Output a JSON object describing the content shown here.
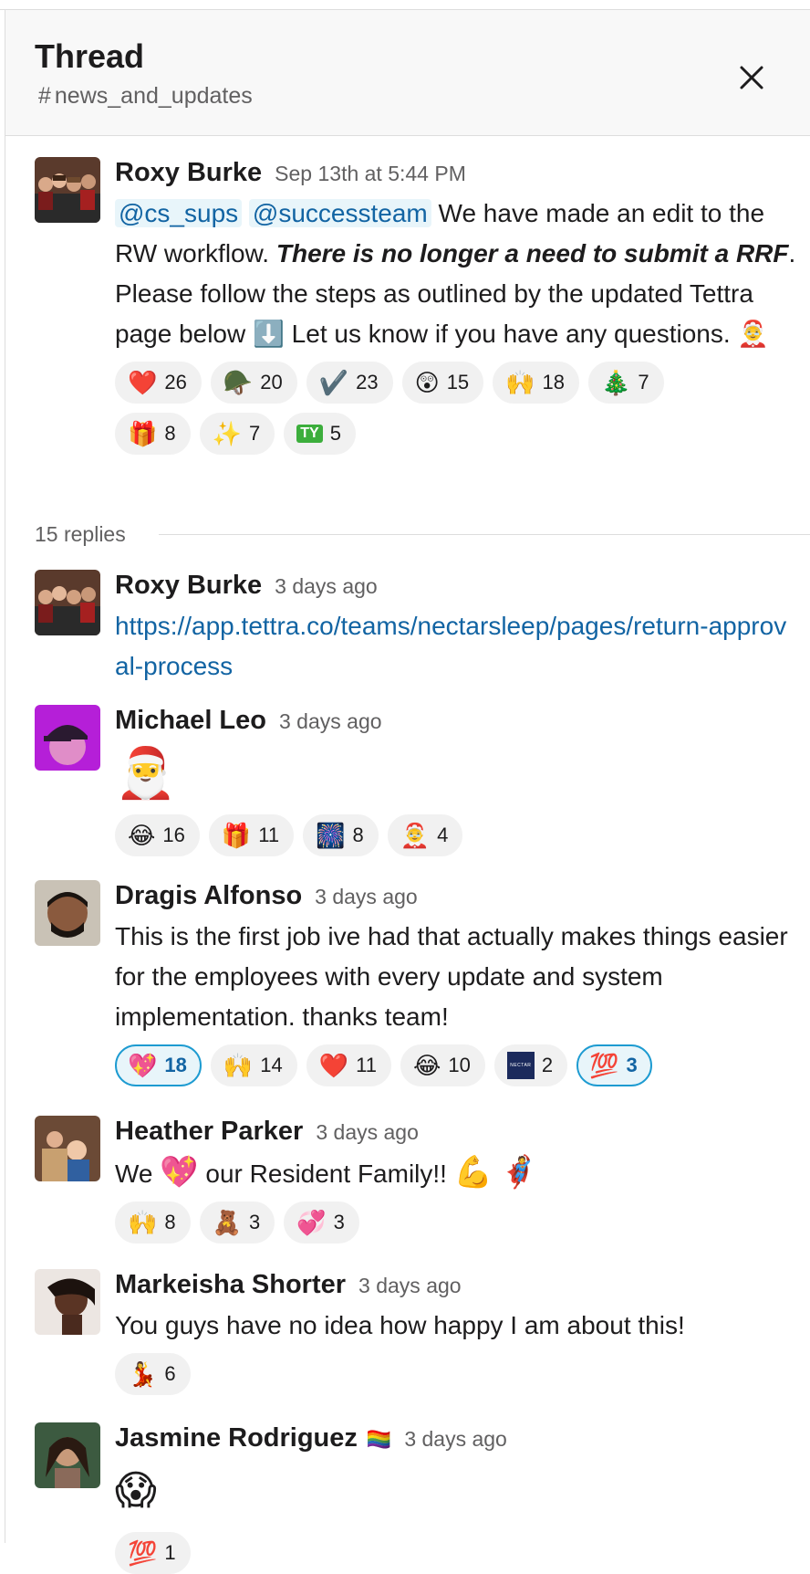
{
  "header": {
    "title": "Thread",
    "channel_hash": "#",
    "channel_name": "news_and_updates"
  },
  "parent": {
    "author": "Roxy Burke",
    "time": "Sep 13th at 5:44 PM",
    "mention1": "@cs_sups",
    "mention2": "@successteam",
    "text_a": " We have made an edit to the RW workflow. ",
    "text_bold": "There is no longer a need to submit a RRF",
    "text_b": ". Please follow the steps as outlined by the updated Tettra page below ",
    "emoji_arrow": "⬇️",
    "text_c": "  Let us know if you have any questions. ",
    "emoji_end": "🤶",
    "reactions": [
      {
        "emoji": "❤️",
        "count": "26"
      },
      {
        "emoji": "🪖",
        "count": "20"
      },
      {
        "emoji": "✔️",
        "count": "23"
      },
      {
        "emoji": "😲",
        "count": "15"
      },
      {
        "emoji": "🙌",
        "count": "18"
      },
      {
        "emoji": "🎄",
        "count": "7"
      },
      {
        "emoji": "🎁",
        "count": "8"
      },
      {
        "emoji": "✨",
        "count": "7"
      },
      {
        "emoji": "TY",
        "count": "5"
      }
    ]
  },
  "replies_label": "15 replies",
  "messages": [
    {
      "author": "Roxy Burke",
      "time": "3 days ago",
      "link": "https://app.tettra.co/teams/nectarsleep/pages/return-approval-process"
    },
    {
      "author": "Michael Leo",
      "time": "3 days ago",
      "big_emoji": "🎅",
      "reactions": [
        {
          "emoji": "😂",
          "count": "16"
        },
        {
          "emoji": "🎁",
          "count": "11"
        },
        {
          "emoji": "🎆",
          "count": "8"
        },
        {
          "emoji": "🤶",
          "count": "4"
        }
      ]
    },
    {
      "author": "Dragis Alfonso",
      "time": "3 days ago",
      "text": "This is the first job ive had that actually makes things easier for the employees with every update and system implementation.  thanks team!",
      "reactions": [
        {
          "emoji": "💖",
          "count": "18",
          "mine": true
        },
        {
          "emoji": "🙌",
          "count": "14"
        },
        {
          "emoji": "❤️",
          "count": "11"
        },
        {
          "emoji": "😂",
          "count": "10"
        },
        {
          "emoji": "NECTAR",
          "count": "2"
        },
        {
          "emoji": "💯",
          "count": "3",
          "mine": true
        }
      ]
    },
    {
      "author": "Heather Parker",
      "time": "3 days ago",
      "text_a": "We ",
      "emoji_a": "💖",
      "text_b": " our Resident Family!! ",
      "emoji_b": "💪",
      "emoji_c": "🦸",
      "reactions": [
        {
          "emoji": "🙌",
          "count": "8"
        },
        {
          "emoji": "🧸",
          "count": "3"
        },
        {
          "emoji": "💞",
          "count": "3"
        }
      ]
    },
    {
      "author": "Markeisha Shorter",
      "time": "3 days ago",
      "text": "You guys have no idea how happy I am about this!",
      "reactions": [
        {
          "emoji": "💃",
          "count": "6"
        }
      ]
    },
    {
      "author": "Jasmine Rodriguez",
      "status_emoji": "🏳️‍🌈",
      "time": "3 days ago",
      "big_emoji": "😱",
      "reactions": [
        {
          "emoji": "💯",
          "count": "1"
        }
      ]
    }
  ]
}
